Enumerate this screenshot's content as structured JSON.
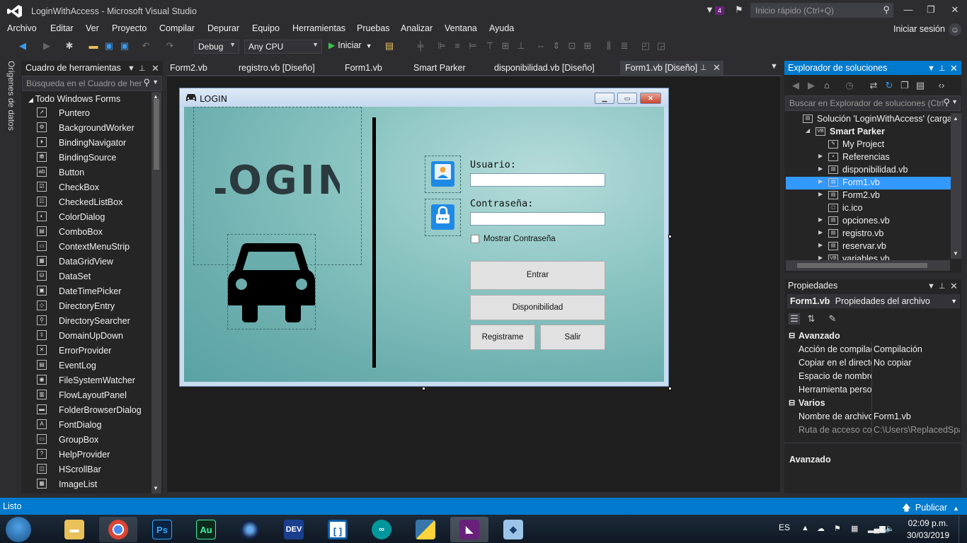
{
  "window": {
    "title": "LoginWithAccess - Microsoft Visual Studio",
    "notification_count": "4"
  },
  "quick_launch": {
    "placeholder": "Inicio rápido (Ctrl+Q)"
  },
  "menu": [
    "Archivo",
    "Editar",
    "Ver",
    "Proyecto",
    "Compilar",
    "Depurar",
    "Equipo",
    "Herramientas",
    "Pruebas",
    "Analizar",
    "Ventana",
    "Ayuda"
  ],
  "account": {
    "signin_label": "Iniciar sesión"
  },
  "toolbar": {
    "config": "Debug",
    "platform": "Any CPU",
    "start_label": "Iniciar"
  },
  "left_strip": {
    "label": "Orígenes de datos"
  },
  "toolbox": {
    "title": "Cuadro de herramientas",
    "search_placeholder": "Búsqueda en el Cuadro de her",
    "group": "Todo Windows Forms",
    "items": [
      "Puntero",
      "BackgroundWorker",
      "BindingNavigator",
      "BindingSource",
      "Button",
      "CheckBox",
      "CheckedListBox",
      "ColorDialog",
      "ComboBox",
      "ContextMenuStrip",
      "DataGridView",
      "DataSet",
      "DateTimePicker",
      "DirectoryEntry",
      "DirectorySearcher",
      "DomainUpDown",
      "ErrorProvider",
      "EventLog",
      "FileSystemWatcher",
      "FlowLayoutPanel",
      "FolderBrowserDialog",
      "FontDialog",
      "GroupBox",
      "HelpProvider",
      "HScrollBar",
      "ImageList"
    ]
  },
  "doc_tabs": [
    "Form2.vb",
    "registro.vb [Diseño]",
    "Form1.vb",
    "Smart Parker",
    "disponibilidad.vb [Diseño]",
    "Form1.vb [Diseño]"
  ],
  "form": {
    "title": "LOGIN",
    "logo_text": "LOGIN",
    "user_label": "Usuario:",
    "user_value": "",
    "pass_label": "Contraseña:",
    "pass_value": "",
    "show_pass": "Mostrar Contraseña",
    "btn_enter": "Entrar",
    "btn_availability": "Disponibilidad",
    "btn_register": "Registrame",
    "btn_exit": "Salir"
  },
  "solution": {
    "title": "Explorador de soluciones",
    "search_placeholder": "Buscar en Explorador de soluciones (Ctrl",
    "tree": [
      {
        "label": "Solución 'LoginWithAccess'  (cargand"
      },
      {
        "label": "Smart Parker"
      },
      {
        "label": "My Project"
      },
      {
        "label": "Referencias"
      },
      {
        "label": "disponibilidad.vb"
      },
      {
        "label": "Form1.vb"
      },
      {
        "label": "Form2.vb"
      },
      {
        "label": "ic.ico"
      },
      {
        "label": "opciones.vb"
      },
      {
        "label": "registro.vb"
      },
      {
        "label": "reservar.vb"
      },
      {
        "label": "variables.vb"
      }
    ]
  },
  "properties": {
    "title": "Propiedades",
    "object_name": "Form1.vb",
    "object_type": "Propiedades del archivo",
    "cat_advanced": "Avanzado",
    "rows_advanced": [
      {
        "name": "Acción de compilación",
        "value": "Compilación"
      },
      {
        "name": "Copiar en el directorio",
        "value": "No copiar"
      },
      {
        "name": "Espacio de nombres",
        "value": ""
      },
      {
        "name": "Herramienta personalizada",
        "value": ""
      }
    ],
    "cat_misc": "Varios",
    "rows_misc": [
      {
        "name": "Nombre de archivo",
        "value": "Form1.vb"
      },
      {
        "name": "Ruta de acceso completa",
        "value": "C:\\Users\\ReplacedSpace"
      }
    ],
    "desc_title": "Avanzado"
  },
  "status": {
    "text": "Listo",
    "publish": "Publicar"
  },
  "taskbar": {
    "lang": "ES",
    "time": "02:09 p.m.",
    "date": "30/03/2019"
  },
  "colors": {
    "accent": "#007acc",
    "bg": "#2d2d30",
    "form_teal": "#6aadad",
    "icon_blue": "#1f8ae6"
  }
}
